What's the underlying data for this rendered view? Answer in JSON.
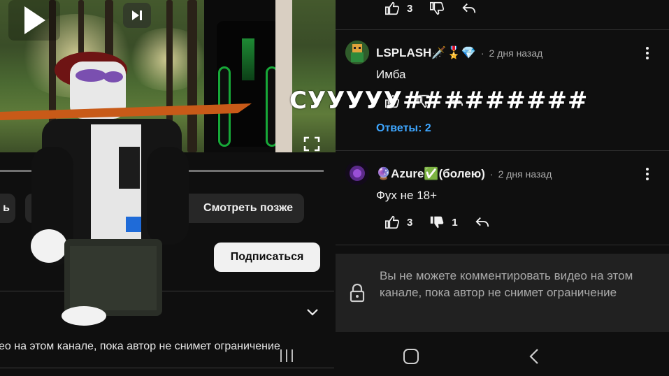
{
  "left_panel": {
    "pill_a_label": "ь",
    "pill_b_label": "",
    "watch_later_label": "Смотреть позже",
    "subscribe_label": "Подписаться",
    "restriction_text": "ео на этом канале, пока автор не снимет ограничение"
  },
  "comments": {
    "top_row": {
      "likes": "3"
    },
    "items": [
      {
        "author": "LSPLASH🗡️🎖️💎",
        "time": "2 дня назад",
        "text": "Имба",
        "likes": "",
        "dislikes": "",
        "replies_label": "Ответы: 2"
      },
      {
        "author": "🔮Azure✅(болею)",
        "time": "2 дня назад",
        "text": "Фух не 18+",
        "likes": "3",
        "dislikes": "1"
      }
    ],
    "restriction_text": "Вы не можете комментировать видео на этом канале, пока автор не снимет ограничение"
  },
  "overlay": {
    "text": "СУУУУУ#########"
  },
  "colors": {
    "background": "#0f0f0f",
    "link": "#3ea6ff",
    "panel": "#212121",
    "chip": "#272727"
  },
  "icons": [
    "play-icon",
    "next-icon",
    "fullscreen-icon",
    "chevron-down-icon",
    "like-icon",
    "dislike-icon",
    "reply-icon",
    "more-icon",
    "lock-icon",
    "home-icon",
    "back-icon",
    "recent-apps-icon"
  ]
}
